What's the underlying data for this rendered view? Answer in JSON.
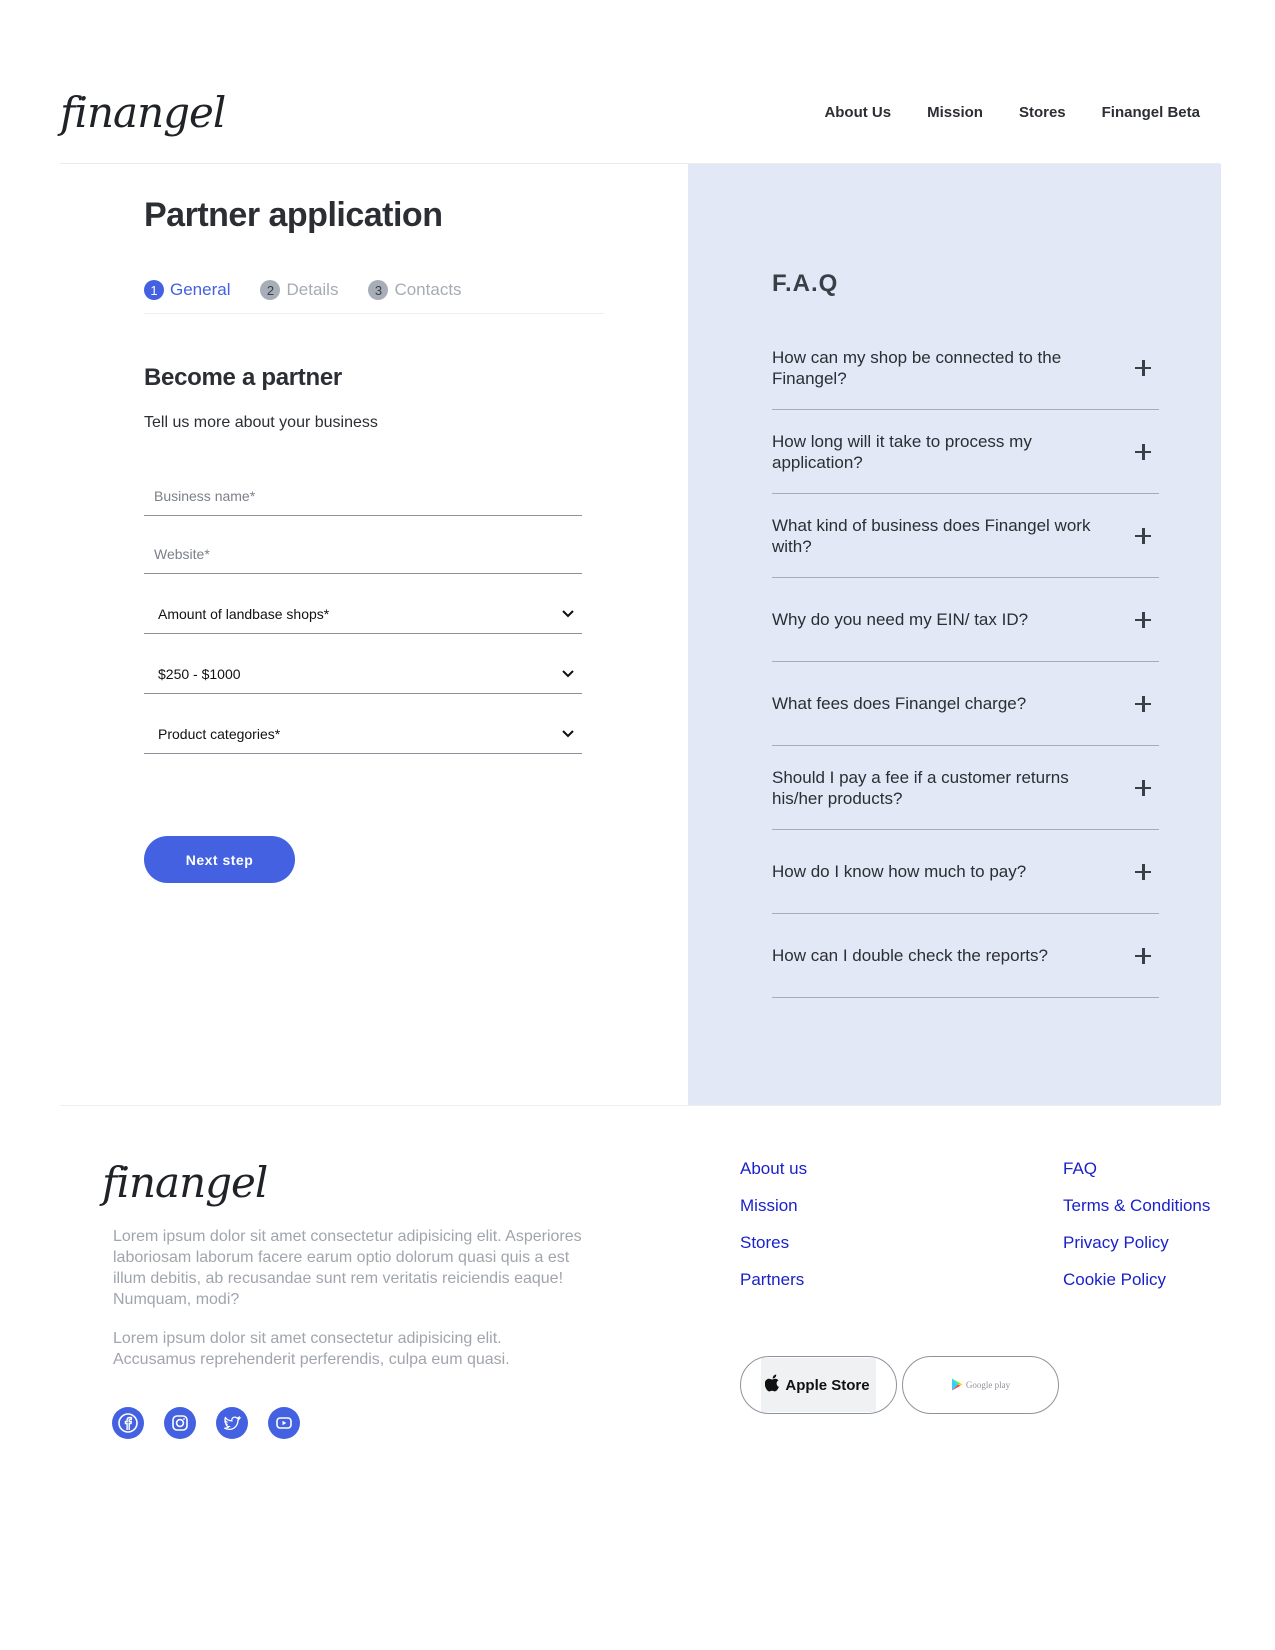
{
  "brand": {
    "logo_text": "finangel"
  },
  "nav": {
    "items": [
      "About Us",
      "Mission",
      "Stores",
      "Finangel Beta"
    ]
  },
  "form": {
    "title": "Partner application",
    "steps": [
      {
        "number": "1",
        "label": "General",
        "active": true
      },
      {
        "number": "2",
        "label": "Details",
        "active": false
      },
      {
        "number": "3",
        "label": "Contacts",
        "active": false
      }
    ],
    "section_title": "Become a partner",
    "section_subtitle": "Tell us more about your business",
    "business_name_placeholder": "Business name*",
    "website_placeholder": "Website*",
    "shops_select": "Amount of landbase shops*",
    "revenue_select": "$250 - $1000",
    "categories_select": "Product categories*",
    "next_label": "Next step"
  },
  "faq": {
    "title": "F.A.Q",
    "items": [
      "How can my shop be connected to the Finangel?",
      "How long will it take to process my application?",
      "What kind of business does Finangel work with?",
      "Why do you need my EIN/ tax ID?",
      "What fees does Finangel charge?",
      "Should I pay a fee if a customer returns his/her products?",
      "How do I know how much to pay?",
      "How can I double check the reports?"
    ]
  },
  "footer": {
    "logo_text": "finangel",
    "paragraph1": "Lorem ipsum dolor sit amet consectetur adipisicing elit. Asperiores laboriosam laborum facere earum optio dolorum quasi quis a est illum debitis, ab recusandae sunt rem veritatis reiciendis eaque! Numquam, modi?",
    "paragraph2": "Lorem ipsum dolor sit amet consectetur adipisicing elit. Accusamus reprehenderit perferendis, culpa eum quasi.",
    "links_col1": [
      "About us",
      "Mission",
      "Stores",
      "Partners"
    ],
    "links_col2": [
      "FAQ",
      "Terms & Conditions",
      "Privacy Policy",
      "Cookie Policy"
    ],
    "apple_store_label": "Apple Store",
    "google_play_label": "Google play",
    "socials": [
      "facebook-icon",
      "instagram-icon",
      "twitter-icon",
      "youtube-icon"
    ]
  },
  "colors": {
    "accent": "#4361e0",
    "faq_background": "#e3e8f6",
    "link": "#1a22c8"
  }
}
